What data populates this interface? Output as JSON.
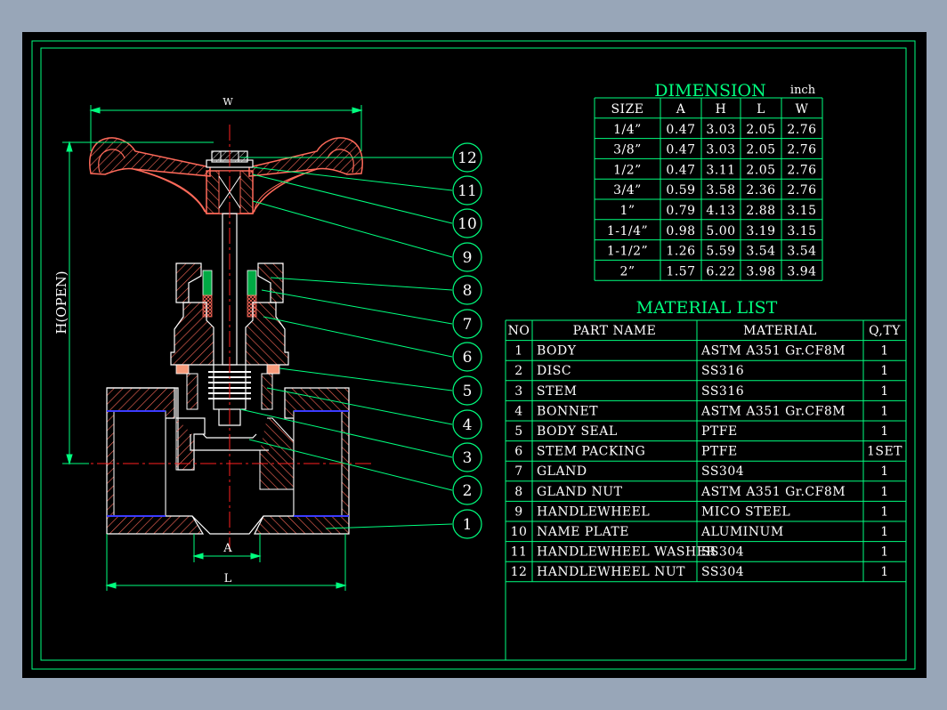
{
  "dimension": {
    "title": "DIMENSION",
    "unit": "inch",
    "headers": [
      "SIZE",
      "A",
      "H",
      "L",
      "W"
    ],
    "rows": [
      [
        "1/4”",
        "0.47",
        "3.03",
        "2.05",
        "2.76"
      ],
      [
        "3/8”",
        "0.47",
        "3.03",
        "2.05",
        "2.76"
      ],
      [
        "1/2”",
        "0.47",
        "3.11",
        "2.05",
        "2.76"
      ],
      [
        "3/4”",
        "0.59",
        "3.58",
        "2.36",
        "2.76"
      ],
      [
        "1”",
        "0.79",
        "4.13",
        "2.88",
        "3.15"
      ],
      [
        "1-1/4”",
        "0.98",
        "5.00",
        "3.19",
        "3.15"
      ],
      [
        "1-1/2”",
        "1.26",
        "5.59",
        "3.54",
        "3.54"
      ],
      [
        "2”",
        "1.57",
        "6.22",
        "3.98",
        "3.94"
      ]
    ]
  },
  "material_list": {
    "title": "MATERIAL  LIST",
    "headers": [
      "NO",
      "PART  NAME",
      "MATERIAL",
      "Q,TY"
    ],
    "rows": [
      [
        "1",
        "BODY",
        "ASTM  A351  Gr.CF8M",
        "1"
      ],
      [
        "2",
        "DISC",
        "SS316",
        "1"
      ],
      [
        "3",
        "STEM",
        "SS316",
        "1"
      ],
      [
        "4",
        "BONNET",
        "ASTM  A351  Gr.CF8M",
        "1"
      ],
      [
        "5",
        "BODY  SEAL",
        "PTFE",
        "1"
      ],
      [
        "6",
        "STEM  PACKING",
        "PTFE",
        "1SET"
      ],
      [
        "7",
        "GLAND",
        "SS304",
        "1"
      ],
      [
        "8",
        "GLAND  NUT",
        "ASTM  A351  Gr.CF8M",
        "1"
      ],
      [
        "9",
        "HANDLEWHEEL",
        "MICO  STEEL",
        "1"
      ],
      [
        "10",
        "NAME  PLATE",
        "ALUMINUM",
        "1"
      ],
      [
        "11",
        "HANDLEWHEEL  WASHER",
        "SS304",
        "1"
      ],
      [
        "12",
        "HANDLEWHEEL  NUT",
        "SS304",
        "1"
      ]
    ]
  },
  "drawing": {
    "dim_labels": {
      "w": "W",
      "h": "H(OPEN)",
      "a": "A",
      "l": "L"
    },
    "balloons": [
      "12",
      "11",
      "10",
      "9",
      "8",
      "7",
      "6",
      "5",
      "4",
      "3",
      "2",
      "1"
    ]
  },
  "colors": {
    "background": "#000000",
    "frame": "#00ff7f",
    "hatch": "#ff6a5a",
    "centerline": "#ff2020",
    "thread": "#3b3bff",
    "text": "#ffffff",
    "outer": "#98a6b8"
  }
}
